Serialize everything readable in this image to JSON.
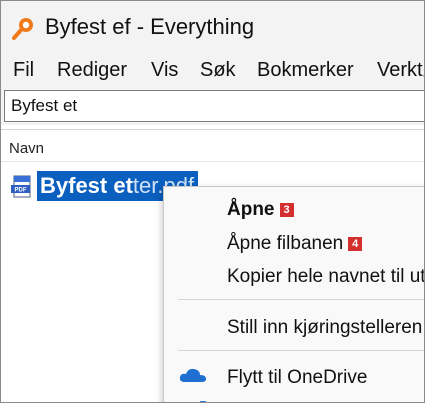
{
  "window": {
    "title": "Byfest ef - Everything",
    "accent": "#0a5fbf"
  },
  "menubar": {
    "items": [
      "Fil",
      "Rediger",
      "Vis",
      "Søk",
      "Bokmerker",
      "Verktøy"
    ]
  },
  "search": {
    "value": "Byfest et"
  },
  "results": {
    "column_header": "Navn",
    "items": [
      {
        "name_match": "Byfest et",
        "name_rest": "ter.pdf",
        "icon": "pdf-icon",
        "selected": true
      }
    ]
  },
  "context_menu": {
    "items": [
      {
        "label": "Åpne",
        "badge": "3",
        "bold": true
      },
      {
        "label": "Åpne filbanen",
        "badge": "4",
        "bold": false
      },
      {
        "label": "Kopier hele navnet til utklippstavlen",
        "badge": "",
        "bold": false
      },
      {
        "label": "Still inn kjøringstelleren",
        "badge": "",
        "bold": false
      },
      {
        "label": "Flytt til OneDrive",
        "badge": "",
        "bold": false,
        "icon": "onedrive-icon"
      }
    ]
  }
}
